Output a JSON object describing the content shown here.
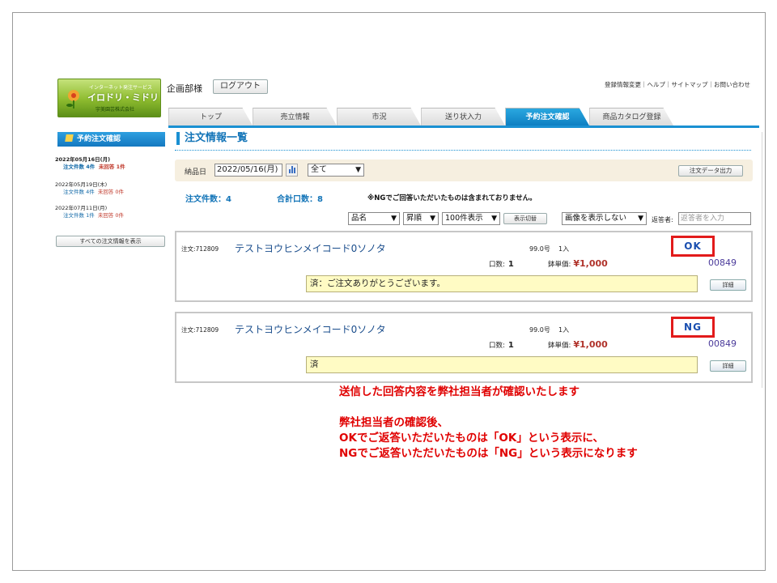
{
  "app": {
    "logo": {
      "line1": "インターネット発注サービス",
      "line2": "イロドリ・ミドリ",
      "line3": "宇美園芸株式会社"
    },
    "department": "企画部様",
    "logout_label": "ログアウト",
    "top_links": "登録情報変更｜ヘルプ｜サイトマップ｜お問い合わせ",
    "tabs": [
      {
        "label": "トップ",
        "active": false
      },
      {
        "label": "売立情報",
        "active": false
      },
      {
        "label": "市況",
        "active": false
      },
      {
        "label": "送り状入力",
        "active": false
      },
      {
        "label": "予約注文確認",
        "active": true
      },
      {
        "label": "商品カタログ登録",
        "active": false
      }
    ]
  },
  "sidebar": {
    "title": "予約注文確認",
    "entries": [
      {
        "date": "2022年05月16日(月)",
        "orders": "注文件数 4件",
        "unanswered": "未回答 1件",
        "current": true
      },
      {
        "date": "2022年05月19日(木)",
        "orders": "注文件数 4件",
        "unanswered": "未回答 0件",
        "current": false
      },
      {
        "date": "2022年07月11日(月)",
        "orders": "注文件数 1件",
        "unanswered": "未回答 0件",
        "current": false
      }
    ],
    "show_all_label": "すべての注文情報を表示"
  },
  "main": {
    "title": "注文情報一覧",
    "filter": {
      "date_label": "納品日",
      "date_value": "2022/05/16(月)",
      "scope_value": "全て",
      "export_label": "注文データ出力"
    },
    "summary": {
      "order_count": "注文件数：4",
      "total_qty": "合計口数：8",
      "note": "※NGでご回答いただいたものは含まれておりません。"
    },
    "controls": {
      "sort_field": "品名",
      "sort_order": "昇順",
      "per_page": "100件表示",
      "switch_label": "表示切替",
      "image_mode": "画像を表示しない",
      "responder_label": "返答者:",
      "responder_placeholder": "返答者を入力"
    },
    "orders": [
      {
        "order_id": "注文:712809",
        "product": "テストヨウヒンメイコード0ソノタ",
        "size": "99.0号",
        "pack": "1入",
        "qty_label": "口数:",
        "qty": "1",
        "price_label": "鉢単価:",
        "price": "¥1,000",
        "code": "00849",
        "status": "OK",
        "message": "済：ご注文ありがとうございます。",
        "detail_label": "詳細"
      },
      {
        "order_id": "注文:712809",
        "product": "テストヨウヒンメイコード0ソノタ",
        "size": "99.0号",
        "pack": "1入",
        "qty_label": "口数:",
        "qty": "1",
        "price_label": "鉢単価:",
        "price": "¥1,000",
        "code": "00849",
        "status": "NG",
        "message": "済",
        "detail_label": "詳細"
      }
    ]
  },
  "explanation": {
    "line1": "送信した回答内容を弊社担当者が確認いたします",
    "line2": "弊社担当者の確認後、",
    "line3": "OKでご返答いただいたものは「OK」という表示に、",
    "line4": "NGでご返答いただいたものは「NG」という表示になります"
  },
  "colors": {
    "accent": "#1a90d2",
    "status_border": "#e21b1b",
    "explanation_text": "#e00000"
  }
}
